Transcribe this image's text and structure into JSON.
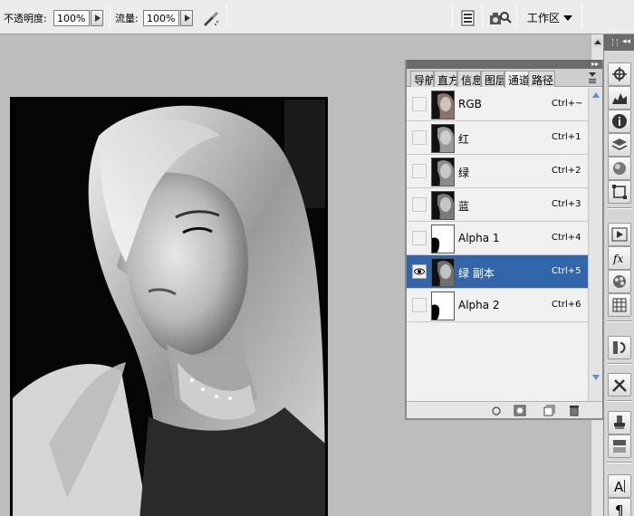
{
  "options_bar": {
    "opacity_label": "不透明度:",
    "opacity_value": "100%",
    "flow_label": "流量:",
    "flow_value": "100%",
    "workspace_label": "工作区"
  },
  "panel": {
    "tabs": [
      {
        "label": "导航"
      },
      {
        "label": "直方"
      },
      {
        "label": "信息"
      },
      {
        "label": "图层"
      },
      {
        "label": "通道",
        "active": true
      },
      {
        "label": "路径"
      }
    ],
    "channels": [
      {
        "name": "RGB",
        "shortcut": "Ctrl+~",
        "visible": false,
        "selected": false
      },
      {
        "name": "红",
        "shortcut": "Ctrl+1",
        "visible": false,
        "selected": false
      },
      {
        "name": "绿",
        "shortcut": "Ctrl+2",
        "visible": false,
        "selected": false
      },
      {
        "name": "蓝",
        "shortcut": "Ctrl+3",
        "visible": false,
        "selected": false
      },
      {
        "name": "Alpha 1",
        "shortcut": "Ctrl+4",
        "visible": false,
        "selected": false
      },
      {
        "name": "绿 副本",
        "shortcut": "Ctrl+5",
        "visible": true,
        "selected": true
      },
      {
        "name": "Alpha 2",
        "shortcut": "Ctrl+6",
        "visible": false,
        "selected": false
      }
    ],
    "bottom_icons": [
      "load-selection-icon",
      "save-selection-icon",
      "new-channel-icon",
      "delete-channel-icon"
    ]
  },
  "dock_icons": [
    "navigator-icon",
    "histogram-icon",
    "info-icon",
    "layers-icon",
    "channels-icon",
    "paths-icon",
    "actions-icon",
    "styles-icon",
    "swatches-icon",
    "color-table-icon",
    "history-icon",
    "tools-icon",
    "clone-source-icon",
    "brushes-icon",
    "character-icon",
    "paragraph-icon"
  ],
  "colors": {
    "selection": "#3366a8",
    "canvas_bg": "#bdbdbd"
  }
}
